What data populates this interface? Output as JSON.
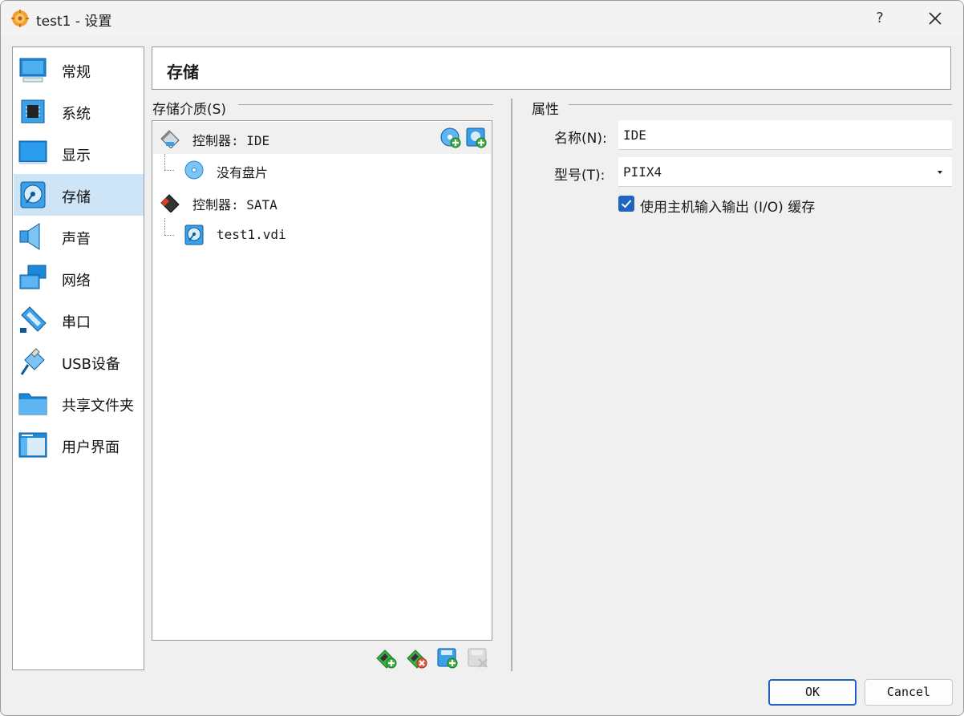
{
  "window": {
    "title": "test1 - 设置",
    "help": "?"
  },
  "sidebar": {
    "items": [
      {
        "label": "常规",
        "icon": "general-icon"
      },
      {
        "label": "系统",
        "icon": "system-chip-icon"
      },
      {
        "label": "显示",
        "icon": "display-monitor-icon"
      },
      {
        "label": "存储",
        "icon": "storage-disk-icon",
        "active": true
      },
      {
        "label": "声音",
        "icon": "speaker-icon"
      },
      {
        "label": "网络",
        "icon": "network-icon"
      },
      {
        "label": "串口",
        "icon": "serial-port-icon"
      },
      {
        "label": "USB设备",
        "icon": "usb-icon"
      },
      {
        "label": "共享文件夹",
        "icon": "shared-folder-icon"
      },
      {
        "label": "用户界面",
        "icon": "user-interface-icon"
      }
    ]
  },
  "page": {
    "title": "存储"
  },
  "storage": {
    "group_label": "存储介质(S)",
    "tree": [
      {
        "label": "控制器: IDE",
        "type": "controller",
        "selected": true
      },
      {
        "label": "没有盘片",
        "type": "optical-empty"
      },
      {
        "label": "控制器: SATA",
        "type": "controller"
      },
      {
        "label": "test1.vdi",
        "type": "hard-disk"
      }
    ]
  },
  "attributes": {
    "group_label": "属性",
    "name_label": "名称(N):",
    "name_value": "IDE",
    "type_label": "型号(T):",
    "type_value": "PIIX4",
    "cache_label": "使用主机输入输出 (I/O) 缓存",
    "cache_checked": true
  },
  "buttons": {
    "ok": "OK",
    "cancel": "Cancel"
  },
  "colors": {
    "accent": "#1f64c0",
    "selection": "#cde5f7"
  }
}
